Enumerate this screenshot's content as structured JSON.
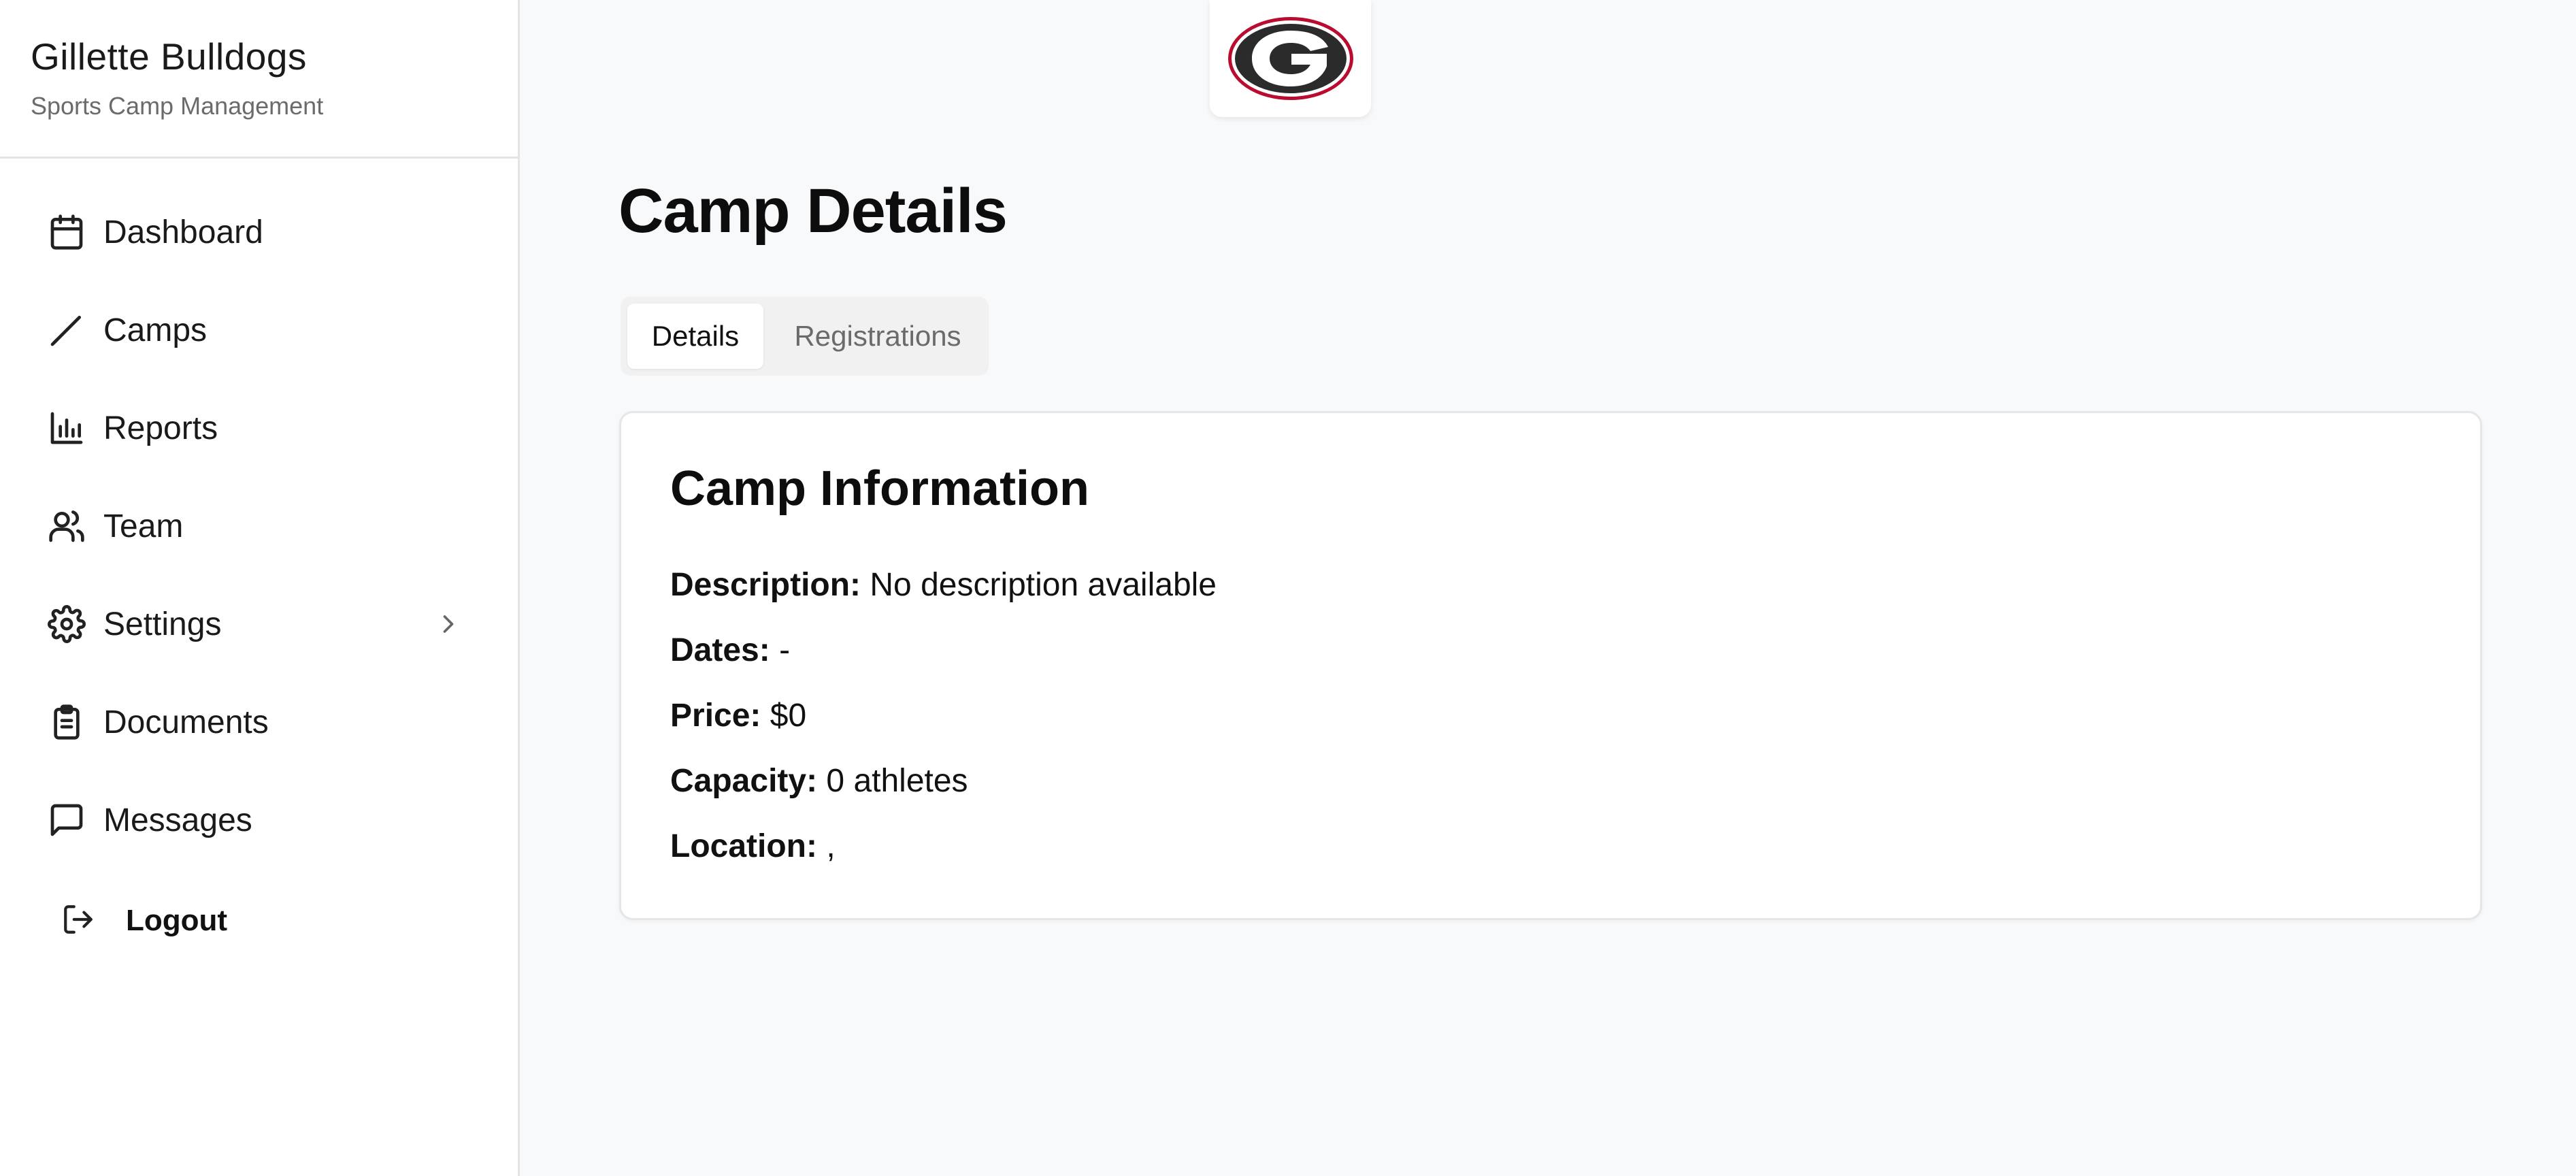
{
  "brand": {
    "title": "Gillette Bulldogs",
    "subtitle": "Sports Camp Management"
  },
  "sidebar": {
    "items": [
      {
        "label": "Dashboard",
        "icon": "calendar-icon"
      },
      {
        "label": "Camps",
        "icon": "baseball-bat-icon"
      },
      {
        "label": "Reports",
        "icon": "bar-chart-icon"
      },
      {
        "label": "Team",
        "icon": "users-icon"
      },
      {
        "label": "Settings",
        "icon": "gear-icon"
      },
      {
        "label": "Documents",
        "icon": "clipboard-icon"
      },
      {
        "label": "Messages",
        "icon": "message-icon"
      }
    ],
    "logout_label": "Logout"
  },
  "page": {
    "title": "Camp Details"
  },
  "tabs": [
    {
      "label": "Details",
      "active": true
    },
    {
      "label": "Registrations",
      "active": false
    }
  ],
  "card": {
    "title": "Camp Information",
    "fields": [
      {
        "label": "Description:",
        "value": "No description available"
      },
      {
        "label": "Dates:",
        "value": "-"
      },
      {
        "label": "Price:",
        "value": "$0"
      },
      {
        "label": "Capacity:",
        "value": "0 athletes"
      },
      {
        "label": "Location:",
        "value": ","
      }
    ]
  },
  "colors": {
    "logo_red": "#ba0c2f",
    "logo_black": "#2b2b2b"
  }
}
